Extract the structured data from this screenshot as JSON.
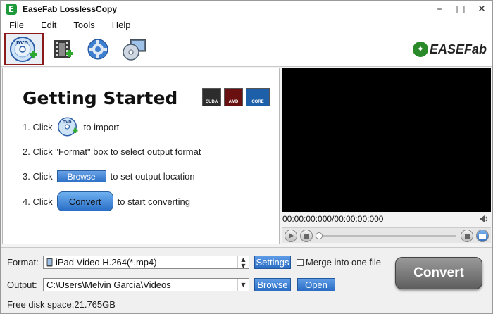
{
  "window": {
    "title": "EaseFab LosslessCopy",
    "app_icon": "E",
    "buttons": {
      "minimize": "–",
      "maximize": "□",
      "close": "✕"
    }
  },
  "menu": [
    "File",
    "Edit",
    "Tools",
    "Help"
  ],
  "toolbar": {
    "items": [
      {
        "icon": "dvd-add-icon",
        "active": true
      },
      {
        "icon": "video-film-icon",
        "active": false
      },
      {
        "icon": "settings-gear-icon",
        "active": false
      },
      {
        "icon": "disc-screen-icon",
        "active": false
      }
    ],
    "logo_text": "EASEFab"
  },
  "getting_started": {
    "title": "Getting Started",
    "badges": [
      "CUDA",
      "AMD",
      "CORE"
    ],
    "step1_prefix": "1. Click",
    "step1_suffix": "to import",
    "step2": "2. Click \"Format\" box to select output format",
    "step3_prefix": "3. Click",
    "step3_button": "Browse",
    "step3_suffix": "to set output location",
    "step4_prefix": "4. Click",
    "step4_button": "Convert",
    "step4_suffix": "to start converting"
  },
  "player": {
    "timecode": "00:00:00:000/00:00:00:000",
    "progress": 0
  },
  "bottom": {
    "format_label": "Format:",
    "format_value": "iPad Video H.264(*.mp4)",
    "settings_button": "Settings",
    "merge_label": "Merge into one file",
    "merge_checked": false,
    "output_label": "Output:",
    "output_value": "C:\\Users\\Melvin Garcia\\Videos",
    "browse_button": "Browse",
    "open_button": "Open",
    "disk_space": "Free disk space:21.765GB",
    "convert_button": "Convert"
  }
}
